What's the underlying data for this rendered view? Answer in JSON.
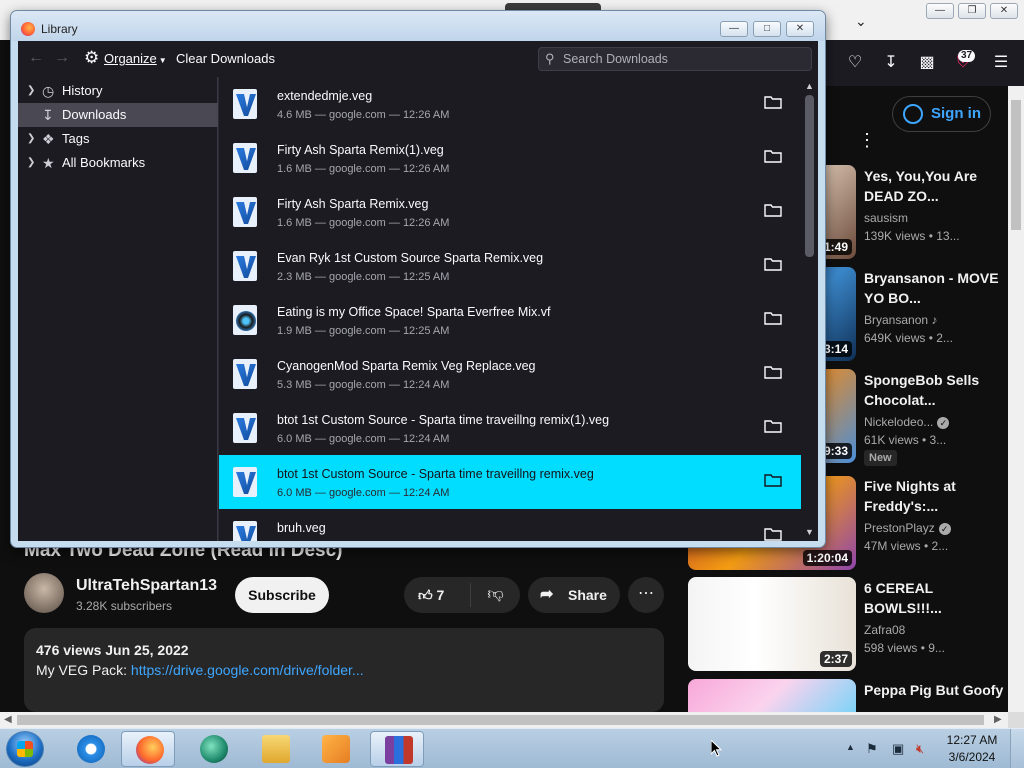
{
  "library": {
    "title": "Library",
    "toolbar": {
      "organize_label": "Organize",
      "clear_downloads_label": "Clear Downloads",
      "search_placeholder": "Search Downloads"
    },
    "sidebar": [
      {
        "label": "History",
        "icon": "clock-icon",
        "expandable": true
      },
      {
        "label": "Downloads",
        "icon": "download-icon",
        "expandable": false,
        "selected": true
      },
      {
        "label": "Tags",
        "icon": "tag-icon",
        "expandable": true
      },
      {
        "label": "All Bookmarks",
        "icon": "star-icon",
        "expandable": true
      }
    ],
    "downloads": [
      {
        "name": "extendedmje.veg",
        "status": "4.6 MB — google.com — 12:26 AM",
        "icon": "vegas-file-icon"
      },
      {
        "name": "Firty Ash Sparta Remix(1).veg",
        "status": "1.6 MB — google.com — 12:26 AM",
        "icon": "vegas-file-icon"
      },
      {
        "name": "Firty Ash Sparta Remix.veg",
        "status": "1.6 MB — google.com — 12:26 AM",
        "icon": "vegas-file-icon"
      },
      {
        "name": "Evan Ryk 1st Custom Source Sparta Remix.veg",
        "status": "2.3 MB — google.com — 12:25 AM",
        "icon": "vegas-file-icon"
      },
      {
        "name": "Eating is my Office Space! Sparta Everfree Mix.vf",
        "status": "1.9 MB — google.com — 12:25 AM",
        "icon": "vf-file-icon"
      },
      {
        "name": "CyanogenMod Sparta Remix Veg Replace.veg",
        "status": "5.3 MB — google.com — 12:24 AM",
        "icon": "vegas-file-icon"
      },
      {
        "name": "btot 1st Custom Source - Sparta time traveillng remix(1).veg",
        "status": "6.0 MB — google.com — 12:24 AM",
        "icon": "vegas-file-icon"
      },
      {
        "name": "btot 1st Custom Source - Sparta time traveillng remix.veg",
        "status": "6.0 MB — google.com — 12:24 AM",
        "icon": "vegas-file-icon",
        "selected": true
      },
      {
        "name": "bruh.veg",
        "status": "",
        "icon": "vegas-file-icon"
      }
    ],
    "selection_color": "#00ddff"
  },
  "browser": {
    "extension_badge": "37",
    "sign_in_label": "Sign in"
  },
  "video": {
    "title_partial": "Max Two Dead Zone (Read in Desc)",
    "channel_name": "UltraTehSpartan13",
    "subscribers": "3.28K subscribers",
    "subscribe_label": "Subscribe",
    "like_count": "7",
    "share_label": "Share",
    "stats": "476 views  Jun 25, 2022",
    "description_prefix": "My VEG Pack: ",
    "description_link": "https://drive.google.com/drive/folder..."
  },
  "recommendations": [
    {
      "title": "Yes, You,You Are DEAD ZO...",
      "channel": "sausism",
      "meta": "139K views  • 13...",
      "duration": "1:49",
      "verified": false,
      "music": false,
      "new": false
    },
    {
      "title": "Bryansanon - MOVE YO BO...",
      "channel": "Bryansanon",
      "meta": "649K views  • 2...",
      "duration": "3:14",
      "verified": false,
      "music": true,
      "new": false
    },
    {
      "title": "SpongeBob Sells Chocolat...",
      "channel": "Nickelodeo...",
      "meta": "61K views  • 3...",
      "duration": "9:33",
      "verified": true,
      "music": false,
      "new": true,
      "new_label": "New"
    },
    {
      "title": "Five Nights at Freddy's:...",
      "channel": "PrestonPlayz",
      "meta": "47M views  • 2...",
      "duration": "1:20:04",
      "verified": true,
      "music": false,
      "new": false
    },
    {
      "title": "6 CEREAL BOWLS!!!...",
      "channel": "Zafra08",
      "meta": "598 views  • 9...",
      "duration": "2:37",
      "verified": false,
      "music": false,
      "new": false
    },
    {
      "title": "Peppa Pig But Goofy",
      "channel": "",
      "meta": "",
      "duration": "",
      "verified": false,
      "music": false,
      "new": false
    }
  ],
  "taskbar": {
    "apps": [
      "internet-explorer-icon",
      "firefox-icon",
      "app-orb-icon",
      "file-explorer-icon",
      "media-player-icon",
      "winrar-icon"
    ],
    "clock_time": "12:27 AM",
    "clock_date": "3/6/2024"
  }
}
